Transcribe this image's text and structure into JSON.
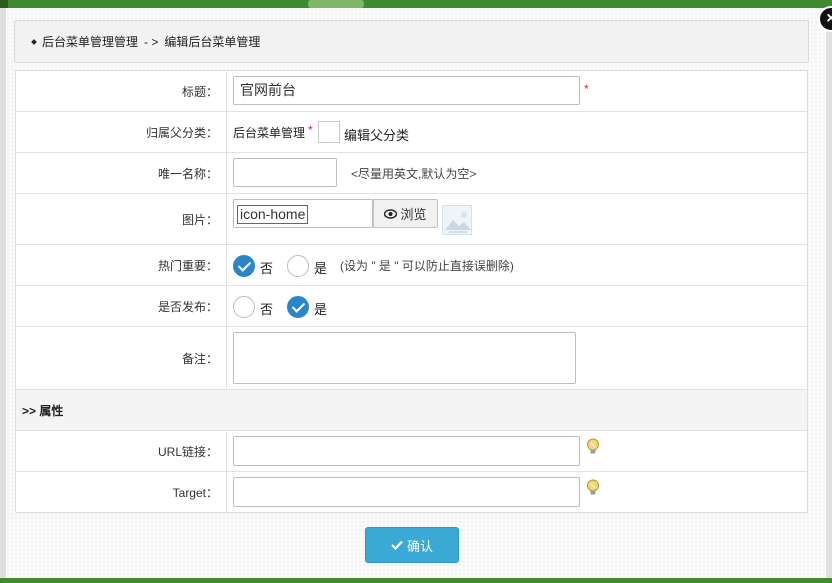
{
  "breadcrumb": {
    "parent": "后台菜单管理管理",
    "separator": "- >",
    "current": "编辑后台菜单管理"
  },
  "close_label": "×",
  "required_mark": "*",
  "fields": {
    "title": {
      "label": "标题：",
      "value": "官网前台"
    },
    "parent_category": {
      "label": "归属父分类：",
      "value": "后台菜单管理",
      "edit_label": "编辑父分类"
    },
    "unique_name": {
      "label": "唯一名称：",
      "value": "",
      "hint": "<尽量用英文,默认为空>"
    },
    "image": {
      "label": "图片：",
      "value": "icon-home",
      "browse_label": "浏览"
    },
    "hot": {
      "label": "热门重要：",
      "options": [
        "否",
        "是"
      ],
      "selected": "否",
      "hint": "(设为 \" 是 \" 可以防止直接误删除)"
    },
    "publish": {
      "label": "是否发布：",
      "options": [
        "否",
        "是"
      ],
      "selected": "是"
    },
    "remark": {
      "label": "备注：",
      "value": ""
    }
  },
  "attributes_section": {
    "title": ">> 属性"
  },
  "url_field": {
    "label": "URL链接：",
    "value": ""
  },
  "target_field": {
    "label": "Target：",
    "value": ""
  },
  "confirm_button": {
    "label": "确认"
  },
  "colors": {
    "accent": "#2a86c8",
    "button": "#3ba9d6",
    "required": "#e02020"
  },
  "icons": [
    "close-icon",
    "eye-icon",
    "lightbulb-icon",
    "checkmark-icon"
  ]
}
